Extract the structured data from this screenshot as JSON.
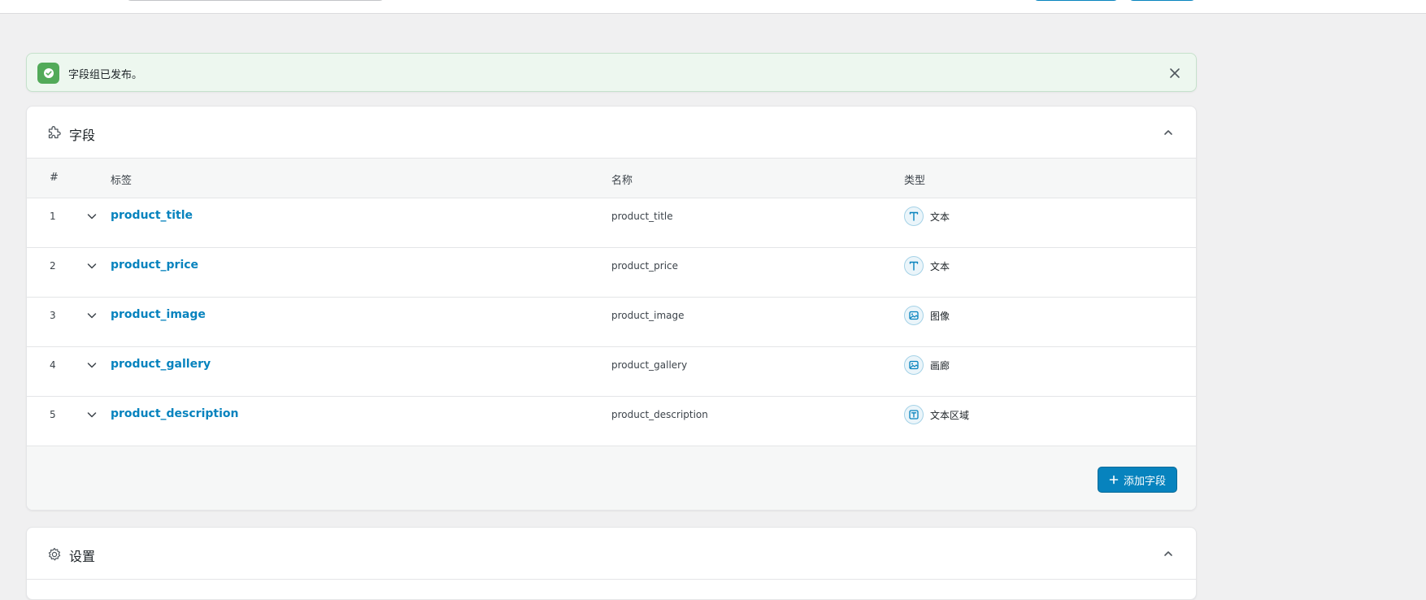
{
  "notice": {
    "text": "字段组已发布。"
  },
  "fields_panel": {
    "title": "字段",
    "columns": {
      "num": "#",
      "label": "标签",
      "name": "名称",
      "type": "类型"
    },
    "rows": [
      {
        "num": "1",
        "label": "product_title",
        "name": "product_title",
        "type": "文本",
        "type_icon": "text-icon"
      },
      {
        "num": "2",
        "label": "product_price",
        "name": "product_price",
        "type": "文本",
        "type_icon": "text-icon"
      },
      {
        "num": "3",
        "label": "product_image",
        "name": "product_image",
        "type": "图像",
        "type_icon": "image-icon"
      },
      {
        "num": "4",
        "label": "product_gallery",
        "name": "product_gallery",
        "type": "画廊",
        "type_icon": "gallery-icon"
      },
      {
        "num": "5",
        "label": "product_description",
        "name": "product_description",
        "type": "文本区域",
        "type_icon": "textarea-icon"
      }
    ],
    "add_button": "添加字段"
  },
  "settings_panel": {
    "title": "设置"
  },
  "colors": {
    "accent": "#0783be",
    "success": "#52aa59",
    "notice_bg": "#edf7ef"
  }
}
